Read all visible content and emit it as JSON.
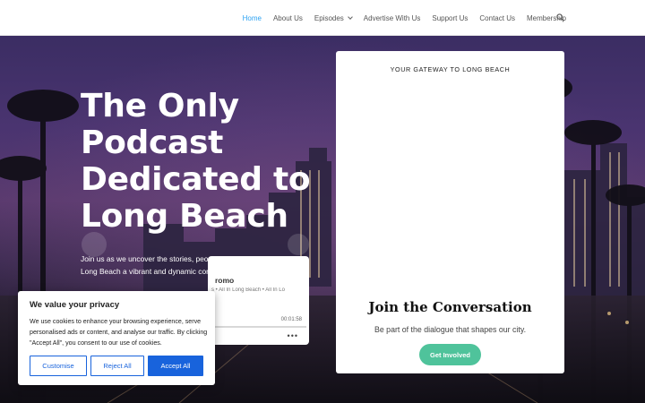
{
  "nav": {
    "items": [
      {
        "label": "Home",
        "active": true
      },
      {
        "label": "About Us"
      },
      {
        "label": "Episodes",
        "has_dropdown": true
      },
      {
        "label": "Advertise With Us"
      },
      {
        "label": "Support Us"
      },
      {
        "label": "Contact Us"
      },
      {
        "label": "Membership"
      }
    ],
    "search_icon": "search-icon",
    "active_color": "#2ea3f2"
  },
  "hero": {
    "title": "The Only Podcast Dedicated to Long Beach",
    "subtitle": "Join us as we uncover the stories, people, and events that make Long Beach a vibrant and dynamic community."
  },
  "player": {
    "title": "romo",
    "meta": "s • All In Long Beach • All In Lo",
    "time": "00:01:58",
    "more_icon": "more-icon"
  },
  "card": {
    "eyebrow": "YOUR GATEWAY TO LONG BEACH",
    "heading": "Join the Conversation",
    "text": "Be part of the dialogue that shapes our city.",
    "button": "Get Involved",
    "button_color": "#4fc39b"
  },
  "cookie": {
    "title": "We value your privacy",
    "text": "We use cookies to enhance your browsing experience, serve personalised ads or content, and analyse our traffic. By clicking \"Accept All\", you consent to our use of cookies.",
    "customise": "Customise",
    "reject": "Reject All",
    "accept": "Accept All",
    "accent": "#1863dc"
  }
}
